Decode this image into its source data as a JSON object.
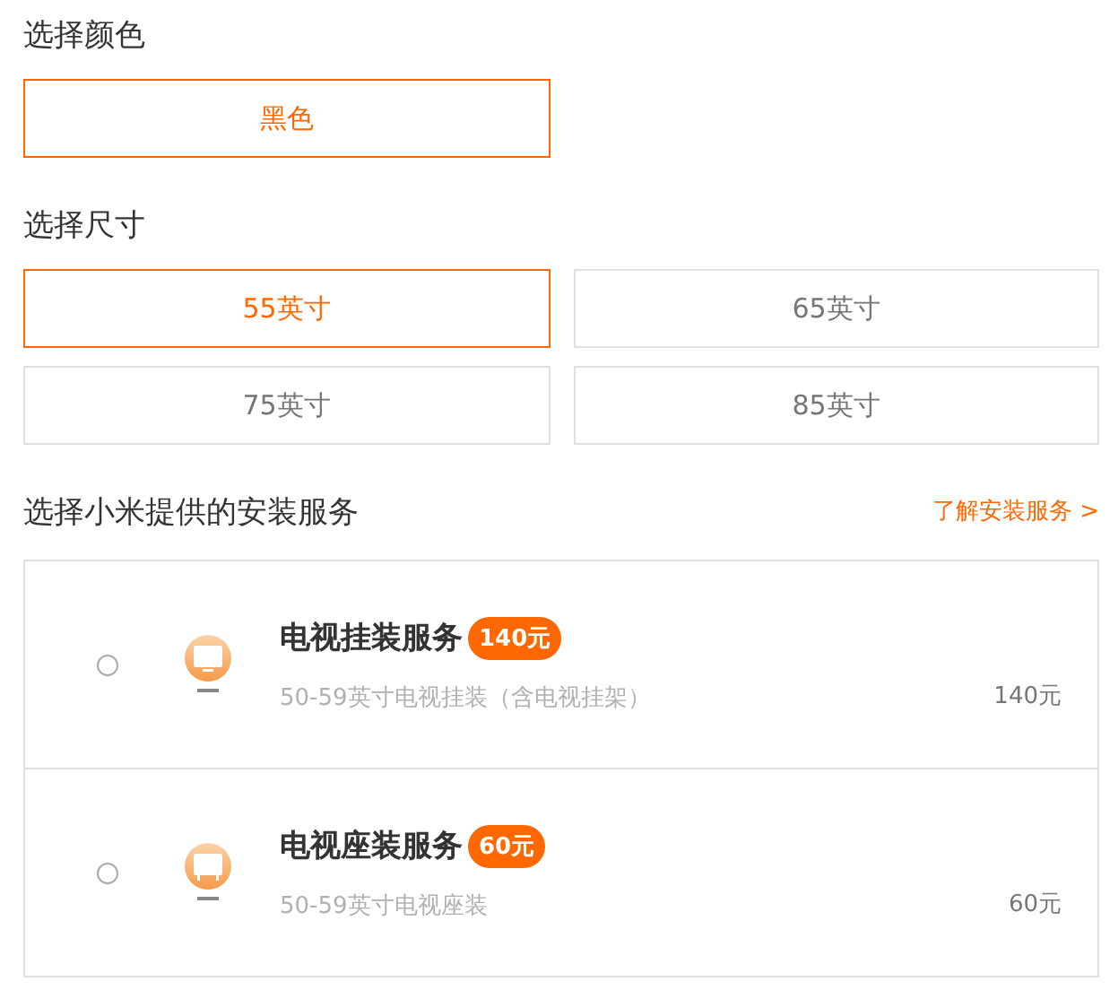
{
  "color_section": {
    "title": "选择颜色",
    "options": [
      {
        "label": "黑色",
        "selected": true
      }
    ]
  },
  "size_section": {
    "title": "选择尺寸",
    "options": [
      {
        "label": "55英寸",
        "selected": true
      },
      {
        "label": "65英寸",
        "selected": false
      },
      {
        "label": "75英寸",
        "selected": false
      },
      {
        "label": "85英寸",
        "selected": false
      }
    ]
  },
  "service_section": {
    "title": "选择小米提供的安装服务",
    "link": "了解安装服务 >",
    "services": [
      {
        "name": "电视挂装服务",
        "badge": "140元",
        "description": "50-59英寸电视挂装（含电视挂架）",
        "price": "140元",
        "selected": false,
        "kind": "wall"
      },
      {
        "name": "电视座装服务",
        "badge": "60元",
        "description": "50-59英寸电视座装",
        "price": "60元",
        "selected": false,
        "kind": "stand"
      }
    ]
  }
}
